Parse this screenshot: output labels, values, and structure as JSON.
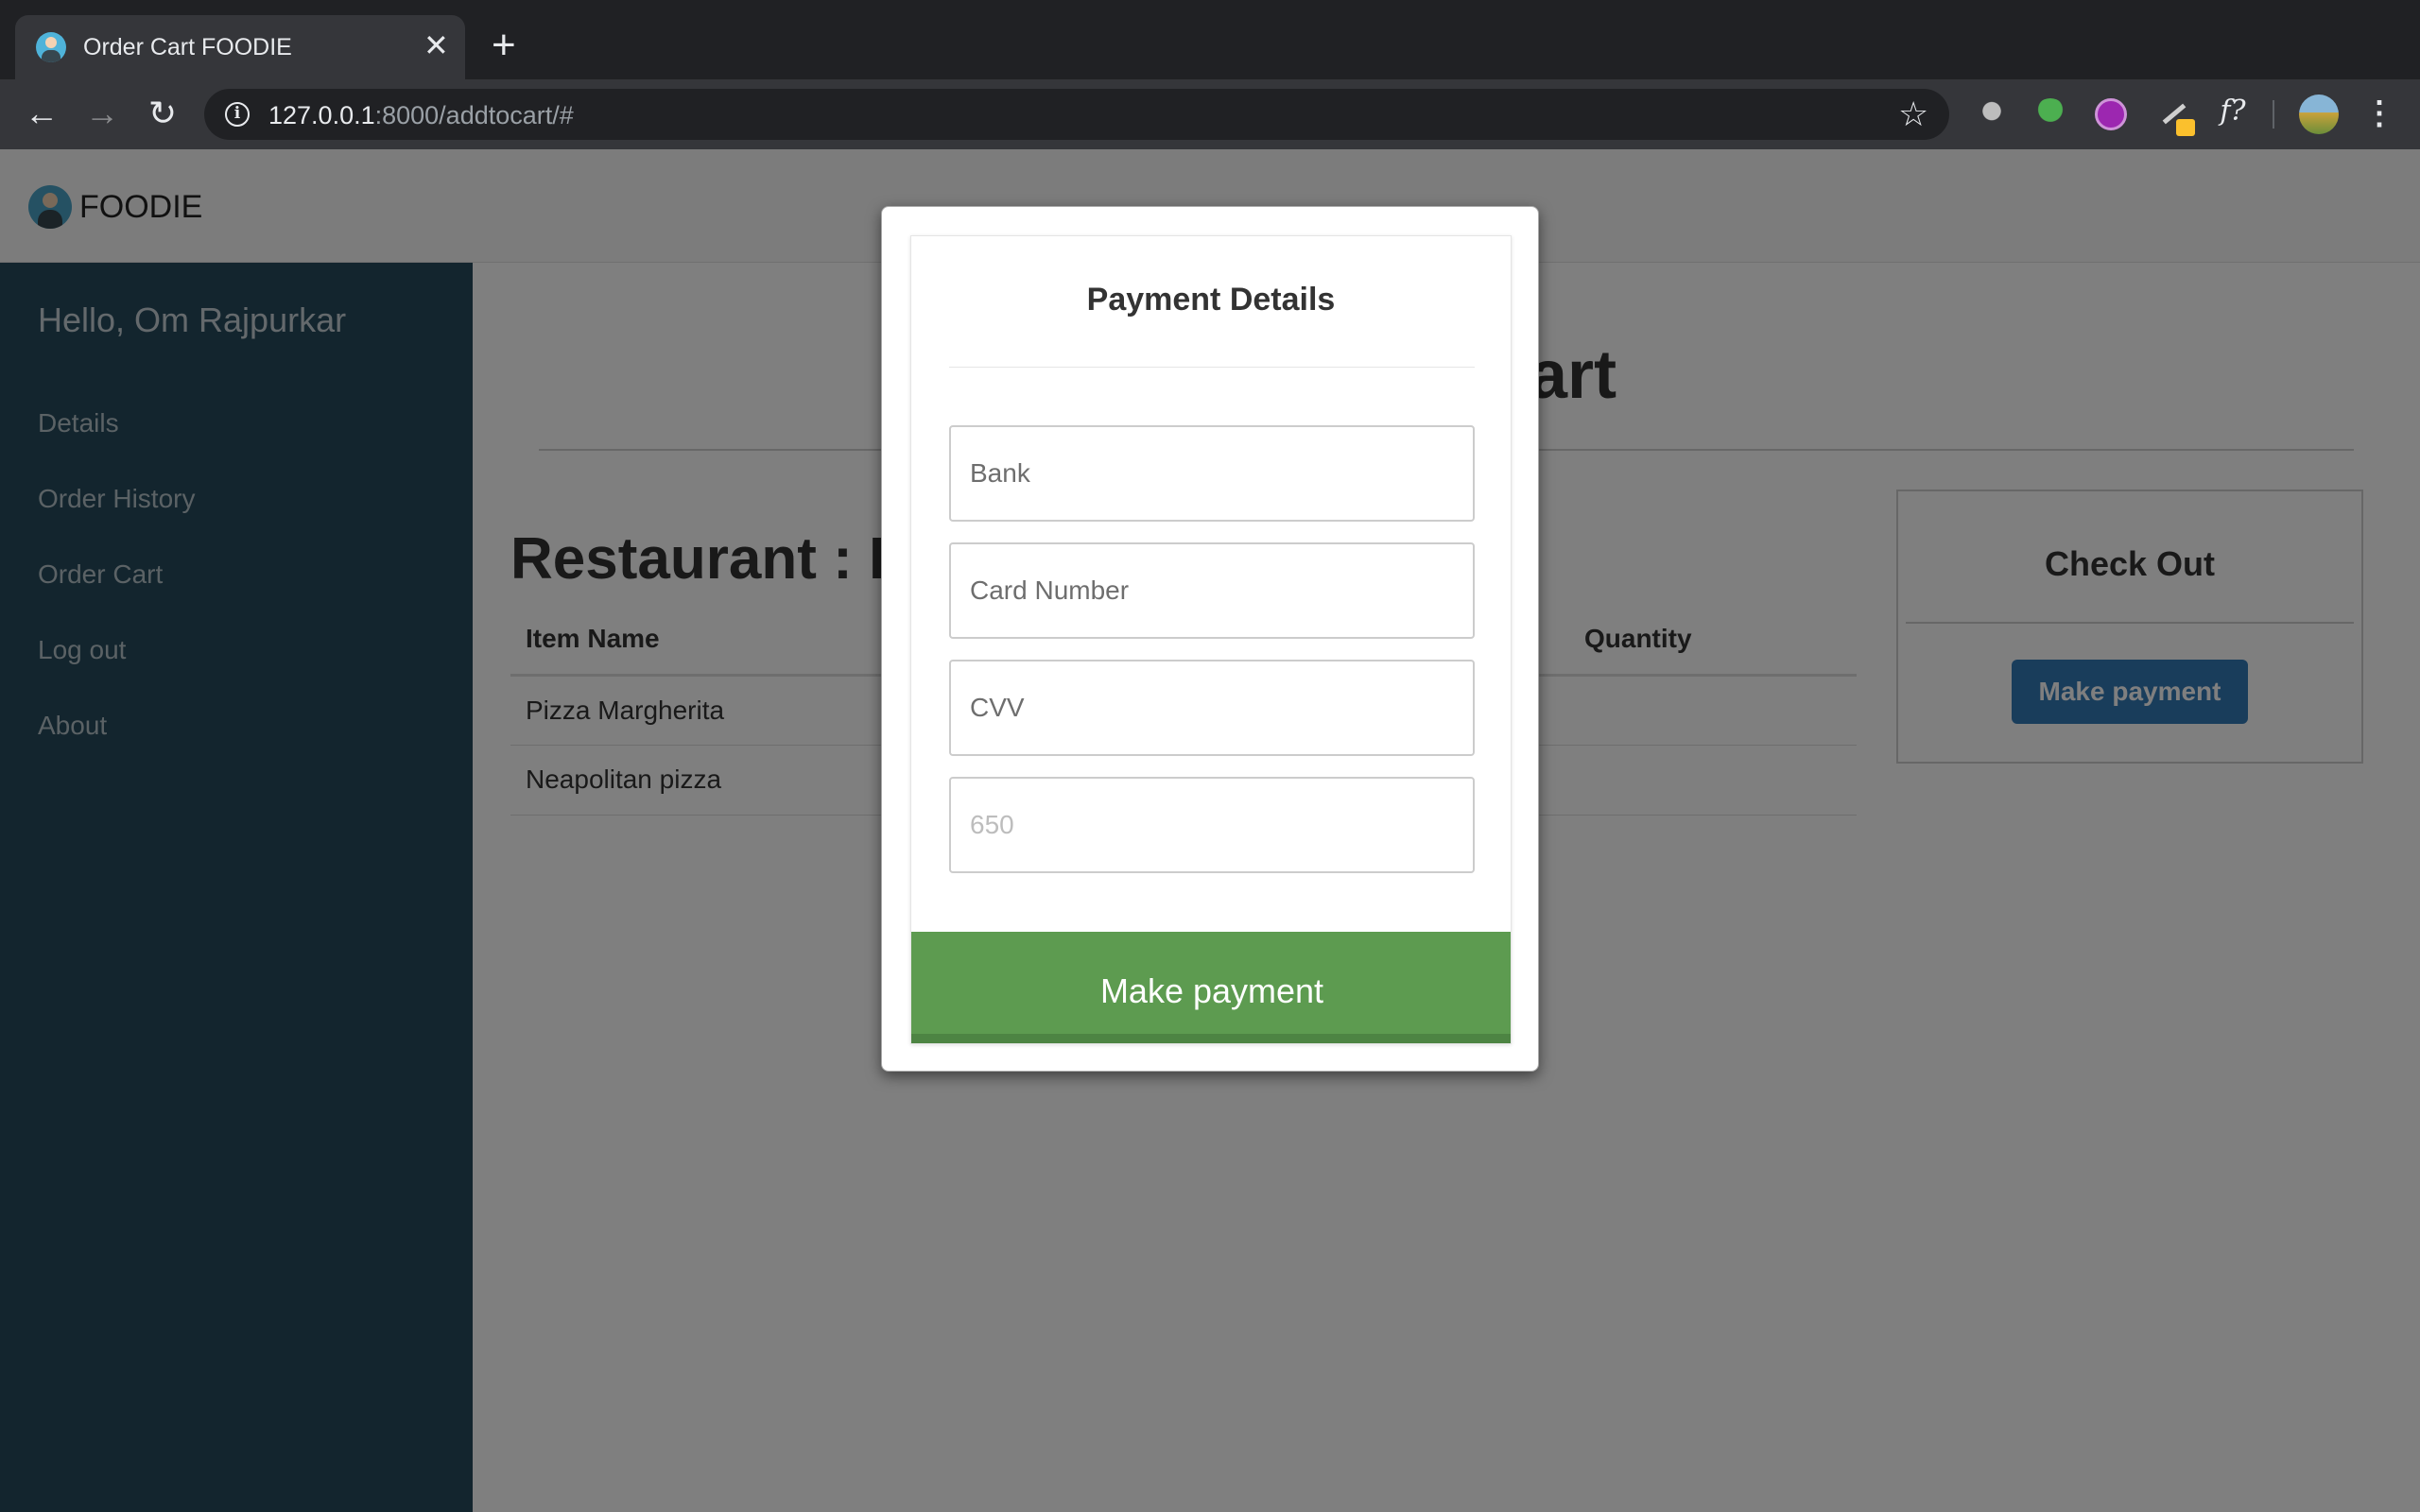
{
  "browser": {
    "tab_title": "Order Cart FOODIE",
    "tab_close": "✕",
    "new_tab": "+",
    "url_host": "127.0.0.1",
    "url_rest": ":8000/addtocart/#",
    "icons": {
      "back": "←",
      "forward": "→",
      "reload": "↻",
      "info": "i",
      "bookmark": "☆",
      "formula": "f?",
      "menu": "⋮"
    }
  },
  "navbar": {
    "brand": "FOODIE"
  },
  "sidebar": {
    "greeting": "Hello, Om Rajpurkar",
    "items": [
      {
        "label": "Details"
      },
      {
        "label": "Order History"
      },
      {
        "label": "Order Cart"
      },
      {
        "label": "Log out"
      },
      {
        "label": "About"
      }
    ]
  },
  "main": {
    "title": "Order Cart",
    "restaurant_heading": "Restaurant : P",
    "table": {
      "headers": [
        "Item Name",
        "",
        "Quantity"
      ],
      "rows": [
        [
          "Pizza Margherita",
          "",
          ""
        ],
        [
          "Neapolitan pizza",
          "",
          ""
        ]
      ]
    },
    "checkout": {
      "title": "Check Out",
      "button_label": "Make payment"
    }
  },
  "modal": {
    "title": "Payment Details",
    "fields": {
      "bank_placeholder": "Bank",
      "card_placeholder": "Card Number",
      "cvv_placeholder": "CVV",
      "amount_placeholder": "650"
    },
    "pay_button": "Make payment"
  },
  "colors": {
    "sidebar_bg": "#264b5d",
    "pay_button": "#5d9b50",
    "checkout_button": "#337ab7"
  }
}
